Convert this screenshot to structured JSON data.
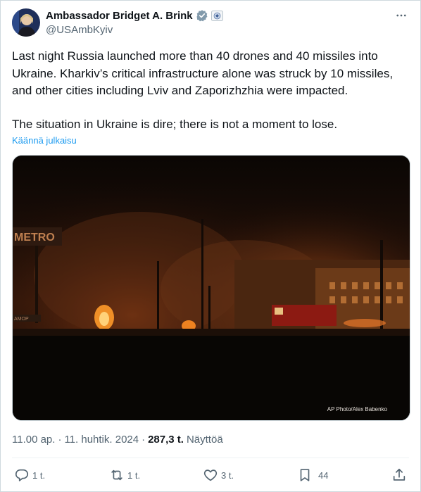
{
  "author": {
    "name": "Ambassador Bridget A. Brink",
    "handle": "@USAmbKyiv"
  },
  "tweet": {
    "paragraph1": "Last night Russia launched more than 40 drones and 40 missiles into Ukraine. Kharkiv’s critical infrastructure alone was struck by 10 missiles, and other cities including Lviv and Zaporizhzhia were impacted.",
    "paragraph2": "The situation in Ukraine is dire; there is not a moment to lose.",
    "translate_label": "Käännä julkaisu"
  },
  "media": {
    "credit": "AP Photo/Alex Babenko",
    "sign_text": "METRO",
    "shop_sign": "АМОР"
  },
  "meta": {
    "time": "11.00 ap.",
    "separator": "·",
    "date": "11. huhtik. 2024",
    "views_count": "287,3 t.",
    "views_label": "Näyttöä"
  },
  "actions": {
    "replies": "1 t.",
    "reposts": "1 t.",
    "likes": "3 t.",
    "bookmarks": "44"
  },
  "colors": {
    "accent": "#1d9bf0",
    "secondary_text": "#536471",
    "verified_badge": "#829aab"
  },
  "icons": [
    "avatar",
    "verified-badge-icon",
    "affiliation-seal-icon",
    "more-icon",
    "reply-icon",
    "repost-icon",
    "like-icon",
    "bookmark-icon",
    "share-icon"
  ]
}
